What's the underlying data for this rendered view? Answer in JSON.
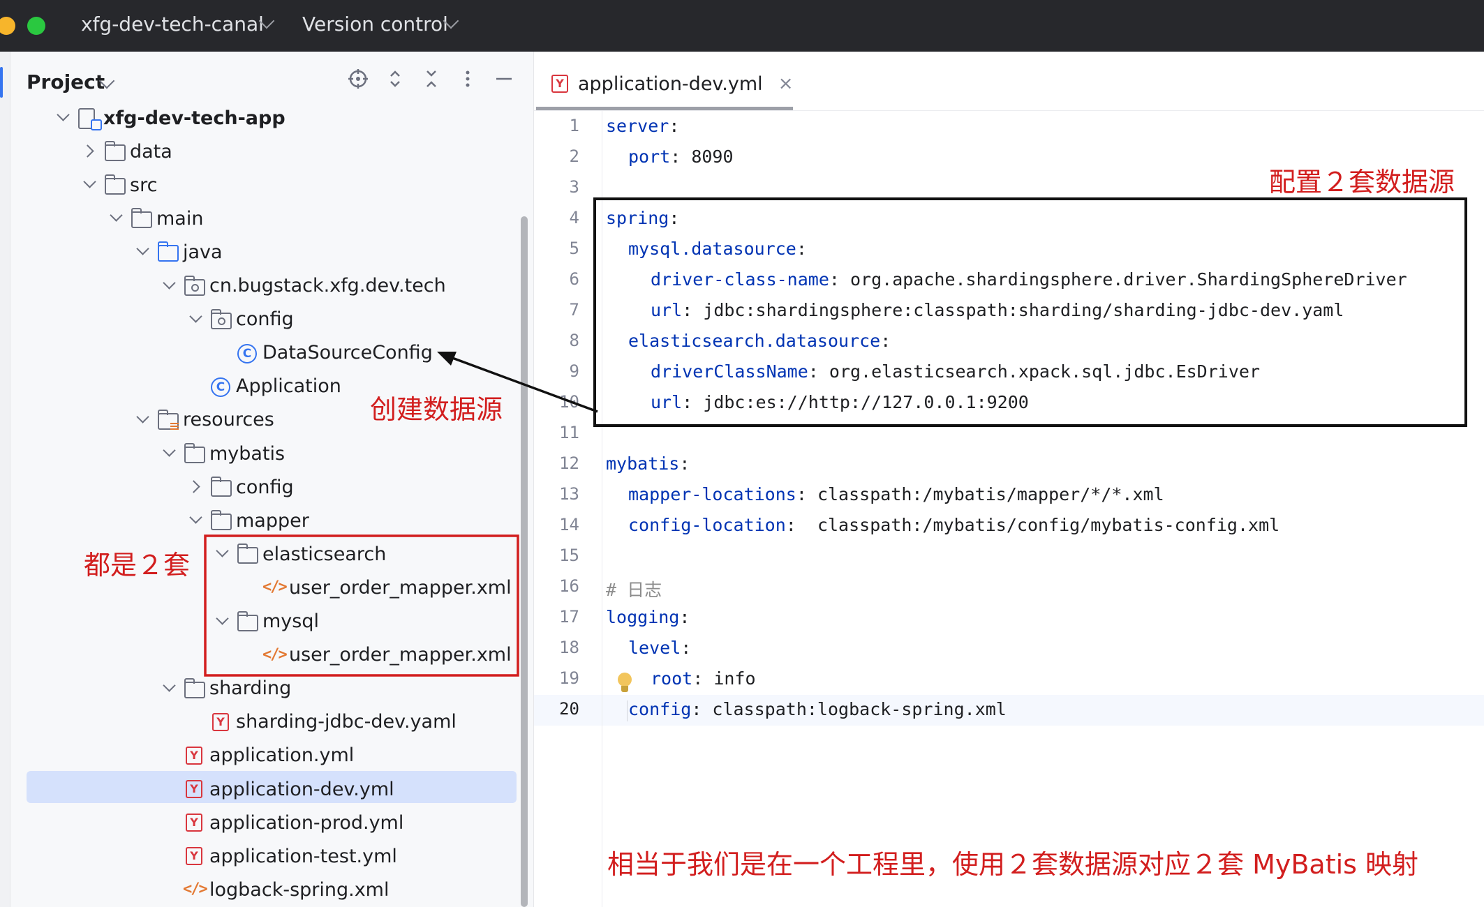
{
  "titlebar": {
    "project_name": "xfg-dev-tech-canal",
    "vcs_label": "Version control"
  },
  "project_panel": {
    "title": "Project",
    "tree": [
      {
        "label": "xfg-dev-tech-app",
        "icon": "module-icon",
        "state": "expanded",
        "depth": 0,
        "bold": true
      },
      {
        "label": "data",
        "icon": "folder-icon",
        "state": "collapsed",
        "depth": 1
      },
      {
        "label": "src",
        "icon": "folder-icon",
        "state": "expanded",
        "depth": 1
      },
      {
        "label": "main",
        "icon": "folder-icon",
        "state": "expanded",
        "depth": 2
      },
      {
        "label": "java",
        "icon": "source-folder-icon",
        "state": "expanded",
        "depth": 3
      },
      {
        "label": "cn.bugstack.xfg.dev.tech",
        "icon": "package-icon",
        "state": "expanded",
        "depth": 4
      },
      {
        "label": "config",
        "icon": "package-icon",
        "state": "expanded",
        "depth": 5
      },
      {
        "label": "DataSourceConfig",
        "icon": "class-icon",
        "state": "leaf",
        "depth": 6
      },
      {
        "label": "Application",
        "icon": "class-icon",
        "state": "leaf",
        "depth": 5
      },
      {
        "label": "resources",
        "icon": "resources-folder-icon",
        "state": "expanded",
        "depth": 3
      },
      {
        "label": "mybatis",
        "icon": "folder-icon",
        "state": "expanded",
        "depth": 4
      },
      {
        "label": "config",
        "icon": "folder-icon",
        "state": "collapsed",
        "depth": 5
      },
      {
        "label": "mapper",
        "icon": "folder-icon",
        "state": "expanded",
        "depth": 5
      },
      {
        "label": "elasticsearch",
        "icon": "folder-icon",
        "state": "expanded",
        "depth": 6
      },
      {
        "label": "user_order_mapper.xml",
        "icon": "xml-file-icon",
        "state": "leaf",
        "depth": 7
      },
      {
        "label": "mysql",
        "icon": "folder-icon",
        "state": "expanded",
        "depth": 6
      },
      {
        "label": "user_order_mapper.xml",
        "icon": "xml-file-icon",
        "state": "leaf",
        "depth": 7
      },
      {
        "label": "sharding",
        "icon": "folder-icon",
        "state": "expanded",
        "depth": 4
      },
      {
        "label": "sharding-jdbc-dev.yaml",
        "icon": "yaml-file-icon",
        "state": "leaf",
        "depth": 5
      },
      {
        "label": "application.yml",
        "icon": "yaml-file-icon",
        "state": "leaf",
        "depth": 4
      },
      {
        "label": "application-dev.yml",
        "icon": "yaml-file-icon",
        "state": "leaf",
        "depth": 4,
        "selected": true
      },
      {
        "label": "application-prod.yml",
        "icon": "yaml-file-icon",
        "state": "leaf",
        "depth": 4
      },
      {
        "label": "application-test.yml",
        "icon": "yaml-file-icon",
        "state": "leaf",
        "depth": 4
      },
      {
        "label": "logback-spring.xml",
        "icon": "xml-file-icon",
        "state": "leaf",
        "depth": 4
      }
    ]
  },
  "editor": {
    "tab_label": "application-dev.yml",
    "current_line": 20,
    "lines": [
      {
        "n": "1",
        "indent": 0,
        "key": "server",
        "sep": ":",
        "value": ""
      },
      {
        "n": "2",
        "indent": 1,
        "key": "port",
        "sep": ": ",
        "value": "8090"
      },
      {
        "n": "3",
        "indent": 0,
        "key": "",
        "sep": "",
        "value": ""
      },
      {
        "n": "4",
        "indent": 0,
        "key": "spring",
        "sep": ":",
        "value": ""
      },
      {
        "n": "5",
        "indent": 1,
        "key": "mysql.datasource",
        "sep": ":",
        "value": ""
      },
      {
        "n": "6",
        "indent": 2,
        "key": "driver-class-name",
        "sep": ": ",
        "value": "org.apache.shardingsphere.driver.ShardingSphereDriver"
      },
      {
        "n": "7",
        "indent": 2,
        "key": "url",
        "sep": ": ",
        "value": "jdbc:shardingsphere:classpath:sharding/sharding-jdbc-dev.yaml"
      },
      {
        "n": "8",
        "indent": 1,
        "key": "elasticsearch.datasource",
        "sep": ":",
        "value": ""
      },
      {
        "n": "9",
        "indent": 2,
        "key": "driverClassName",
        "sep": ": ",
        "value": "org.elasticsearch.xpack.sql.jdbc.EsDriver"
      },
      {
        "n": "10",
        "indent": 2,
        "key": "url",
        "sep": ": ",
        "value": "jdbc:es://http://127.0.0.1:9200"
      },
      {
        "n": "11",
        "indent": 0,
        "key": "",
        "sep": "",
        "value": ""
      },
      {
        "n": "12",
        "indent": 0,
        "key": "mybatis",
        "sep": ":",
        "value": ""
      },
      {
        "n": "13",
        "indent": 1,
        "key": "mapper-locations",
        "sep": ": ",
        "value": "classpath:/mybatis/mapper/*/*.xml"
      },
      {
        "n": "14",
        "indent": 1,
        "key": "config-location",
        "sep": ":  ",
        "value": "classpath:/mybatis/config/mybatis-config.xml"
      },
      {
        "n": "15",
        "indent": 0,
        "key": "",
        "sep": "",
        "value": ""
      },
      {
        "n": "16",
        "indent": 0,
        "key": "",
        "sep": "",
        "value": "",
        "comment": "# 日志"
      },
      {
        "n": "17",
        "indent": 0,
        "key": "logging",
        "sep": ":",
        "value": ""
      },
      {
        "n": "18",
        "indent": 1,
        "key": "level",
        "sep": ":",
        "value": ""
      },
      {
        "n": "19",
        "indent": 2,
        "key": "root",
        "sep": ": ",
        "value": "info"
      },
      {
        "n": "20",
        "indent": 1,
        "key": "config",
        "sep": ": ",
        "value": "classpath:logback-spring.xml"
      }
    ]
  },
  "annotations": {
    "config_two_datasources": "配置２套数据源",
    "create_datasource": "创建数据源",
    "both_two_sets": "都是２套",
    "summary": "相当于我们是在一个工程里，使用２套数据源对应２套 MyBatis 映射"
  },
  "colors": {
    "annotation_red": "#d21e1e",
    "yaml_key_blue": "#0033b3",
    "selection_blue": "#d5e1fc",
    "accent_blue": "#3574f0",
    "titlebar_dark": "#27282c"
  }
}
